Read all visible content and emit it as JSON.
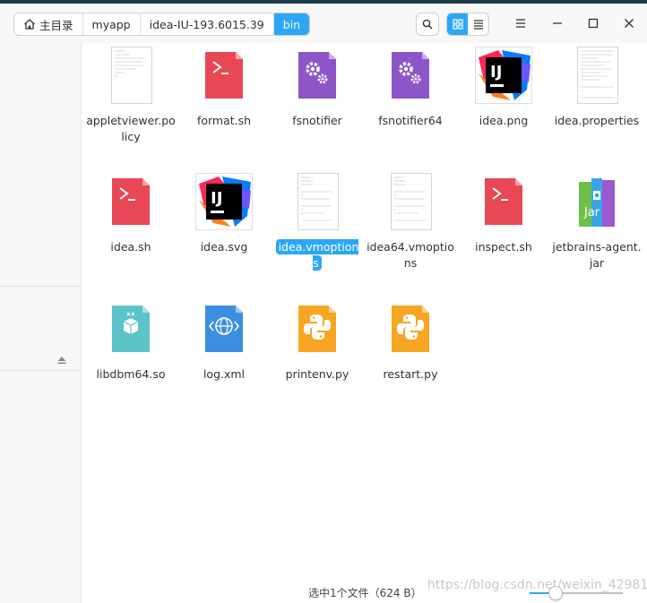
{
  "breadcrumb": [
    "主目录",
    "myapp",
    "idea-IU-193.6015.39",
    "bin"
  ],
  "files": [
    {
      "name": "appletviewer.policy",
      "icon": "document-thumbnail",
      "selected": false
    },
    {
      "name": "format.sh",
      "icon": "shell-script-icon",
      "selected": false
    },
    {
      "name": "fsnotifier",
      "icon": "executable-gear-icon",
      "selected": false
    },
    {
      "name": "fsnotifier64",
      "icon": "executable-gear-icon",
      "selected": false
    },
    {
      "name": "idea.png",
      "icon": "intellij-logo",
      "selected": false
    },
    {
      "name": "idea.properties",
      "icon": "document-thumbnail",
      "selected": false
    },
    {
      "name": "idea.sh",
      "icon": "shell-script-icon",
      "selected": false
    },
    {
      "name": "idea.svg",
      "icon": "intellij-logo",
      "selected": false
    },
    {
      "name": "idea.vmoptions",
      "icon": "document-thumbnail",
      "selected": true
    },
    {
      "name": "idea64.vmoptions",
      "icon": "document-thumbnail",
      "selected": false
    },
    {
      "name": "inspect.sh",
      "icon": "shell-script-icon",
      "selected": false
    },
    {
      "name": "jetbrains-agent.jar",
      "icon": "jar-archive-icon",
      "selected": false
    },
    {
      "name": "libdbm64.so",
      "icon": "shared-library-icon",
      "selected": false
    },
    {
      "name": "log.xml",
      "icon": "xml-file-icon",
      "selected": false
    },
    {
      "name": "printenv.py",
      "icon": "python-file-icon",
      "selected": false
    },
    {
      "name": "restart.py",
      "icon": "python-file-icon",
      "selected": false
    }
  ],
  "jar_label": "Jar",
  "status": {
    "text": "选中1个文件（624 B）",
    "zoom_level": 0.27
  },
  "watermark": "https://blog.csdn.net/weixin_42981168",
  "colors": {
    "accent": "#2ca7f8",
    "shell": "#e84855",
    "executable": "#8c56c8",
    "library": "#5cc4c8",
    "xml": "#3c8ee0",
    "python": "#f6a623"
  }
}
